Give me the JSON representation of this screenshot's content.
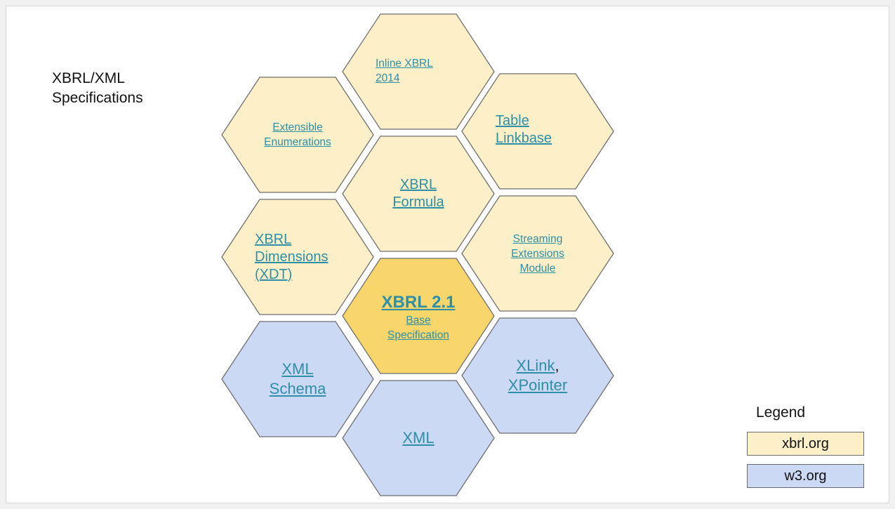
{
  "title_line1": "XBRL/XML",
  "title_line2": "Specifications",
  "colors": {
    "xbrl_org": "#fdf0c8",
    "xbrl_core": "#f8d66b",
    "w3_org": "#cbd9f5",
    "hex_border": "#6e6e6e",
    "link": "#2e8fa6"
  },
  "hexes": {
    "inline": {
      "line1": "Inline XBRL",
      "line2": "2014"
    },
    "enum": {
      "line1": "Extensible",
      "line2": "Enumerations"
    },
    "table": {
      "line1": "Table",
      "line2": "Linkbase"
    },
    "formula": {
      "line1": "XBRL",
      "line2": "Formula"
    },
    "dims": {
      "line1": "XBRL",
      "line2": "Dimensions",
      "line3": "(XDT)"
    },
    "streaming": {
      "line1": "Streaming",
      "line2": "Extensions",
      "line3": "Module"
    },
    "core": {
      "line1": "XBRL 2.1",
      "line2": "Base",
      "line3": "Specification"
    },
    "schema": {
      "line1": "XML",
      "line2": "Schema"
    },
    "xlink": {
      "line1": "XLink",
      "line1_suffix": ",",
      "line2": "XPointer"
    },
    "xml": {
      "line1": "XML"
    }
  },
  "legend": {
    "title": "Legend",
    "items": [
      {
        "label": "xbrl.org",
        "color": "#fdf0c8"
      },
      {
        "label": "w3.org",
        "color": "#cbd9f5"
      }
    ]
  }
}
